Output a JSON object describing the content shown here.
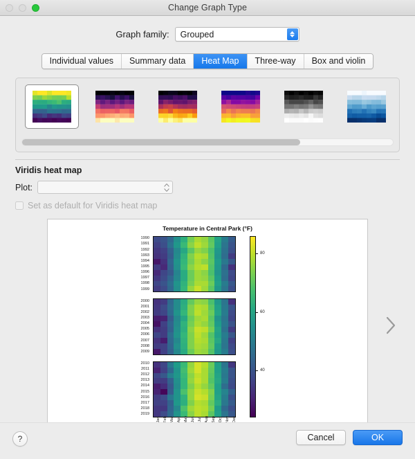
{
  "window": {
    "title": "Change Graph Type",
    "traffic_lights": [
      "close-disabled",
      "minimize-disabled",
      "zoom-green"
    ]
  },
  "family": {
    "label": "Graph family:",
    "selected": "Grouped",
    "stepper_icon": "stepper-up-down-icon"
  },
  "tabs": [
    {
      "label": "Individual values",
      "selected": false
    },
    {
      "label": "Summary data",
      "selected": false
    },
    {
      "label": "Heat Map",
      "selected": true
    },
    {
      "label": "Three-way",
      "selected": false
    },
    {
      "label": "Box and violin",
      "selected": false
    }
  ],
  "gallery": {
    "thumbnails": [
      {
        "name": "viridis-heat-map-thumb",
        "colormap": "viridis",
        "selected": true
      },
      {
        "name": "magma-heat-map-thumb",
        "colormap": "magma",
        "selected": false
      },
      {
        "name": "inferno-heat-map-thumb",
        "colormap": "inferno",
        "selected": false
      },
      {
        "name": "plasma-heat-map-thumb",
        "colormap": "plasma",
        "selected": false
      },
      {
        "name": "greys-heat-map-thumb",
        "colormap": "greys",
        "selected": false
      },
      {
        "name": "blues-heat-map-thumb",
        "colormap": "blues",
        "selected": false
      }
    ],
    "scroll_thumb_percent": 75
  },
  "section": {
    "title": "Viridis heat map",
    "plot_label": "Plot:",
    "plot_value": "",
    "checkbox_label": "Set as default for Viridis heat map",
    "checkbox_checked": false,
    "checkbox_enabled": false
  },
  "preview": {
    "next_arrow_icon": "chevron-right-icon"
  },
  "footer": {
    "help_label": "?",
    "cancel_label": "Cancel",
    "ok_label": "OK",
    "ok_color": "#1876e8"
  },
  "chart_data": {
    "type": "heatmap",
    "title": "Temperature in Central Park (°F)",
    "xlabel": "",
    "ylabel": "",
    "colormap": "viridis",
    "colorbar": {
      "ticks": [
        40,
        60,
        80
      ],
      "min": 24,
      "max": 86
    },
    "categories": [
      "Jan",
      "Feb",
      "Mar",
      "Apr",
      "May",
      "Jun",
      "Jul",
      "Aug",
      "Sep",
      "Oct",
      "Nov",
      "Dec"
    ],
    "row_blocks": [
      {
        "rows": [
          "1990",
          "1991",
          "1992",
          "1993",
          "1994",
          "1995",
          "1996",
          "1997",
          "1998",
          "1999"
        ],
        "values": [
          [
            38,
            40,
            45,
            55,
            63,
            73,
            78,
            76,
            70,
            60,
            50,
            42
          ],
          [
            36,
            39,
            47,
            57,
            66,
            75,
            80,
            77,
            71,
            59,
            48,
            40
          ],
          [
            34,
            36,
            43,
            53,
            61,
            70,
            76,
            74,
            68,
            57,
            47,
            39
          ],
          [
            33,
            35,
            42,
            54,
            64,
            74,
            79,
            78,
            69,
            56,
            46,
            35
          ],
          [
            28,
            33,
            44,
            56,
            65,
            73,
            78,
            75,
            70,
            58,
            49,
            41
          ],
          [
            35,
            31,
            43,
            55,
            66,
            75,
            79,
            80,
            69,
            57,
            45,
            33
          ],
          [
            31,
            37,
            41,
            52,
            62,
            72,
            77,
            75,
            68,
            56,
            47,
            38
          ],
          [
            34,
            38,
            44,
            53,
            62,
            72,
            77,
            76,
            70,
            58,
            46,
            37
          ],
          [
            37,
            40,
            46,
            56,
            64,
            73,
            78,
            78,
            72,
            59,
            50,
            41
          ],
          [
            35,
            38,
            45,
            55,
            65,
            76,
            81,
            77,
            70,
            57,
            48,
            39
          ]
        ]
      },
      {
        "rows": [
          "2000",
          "2001",
          "2002",
          "2003",
          "2004",
          "2005",
          "2006",
          "2007",
          "2008",
          "2009"
        ],
        "values": [
          [
            33,
            35,
            45,
            54,
            62,
            71,
            76,
            75,
            68,
            57,
            48,
            33
          ],
          [
            34,
            38,
            46,
            54,
            63,
            74,
            79,
            78,
            70,
            59,
            49,
            40
          ],
          [
            35,
            37,
            45,
            56,
            65,
            74,
            80,
            77,
            72,
            60,
            50,
            38
          ],
          [
            29,
            30,
            42,
            53,
            61,
            72,
            77,
            78,
            70,
            56,
            48,
            37
          ],
          [
            27,
            36,
            44,
            54,
            64,
            73,
            78,
            76,
            71,
            58,
            49,
            40
          ],
          [
            33,
            35,
            43,
            55,
            63,
            75,
            81,
            80,
            73,
            60,
            47,
            35
          ],
          [
            37,
            35,
            46,
            56,
            65,
            74,
            80,
            77,
            69,
            59,
            50,
            41
          ],
          [
            33,
            29,
            45,
            53,
            64,
            74,
            79,
            78,
            70,
            61,
            49,
            36
          ],
          [
            35,
            36,
            44,
            55,
            63,
            74,
            78,
            77,
            71,
            58,
            48,
            38
          ],
          [
            28,
            36,
            43,
            53,
            62,
            72,
            77,
            76,
            69,
            57,
            50,
            39
          ]
        ]
      },
      {
        "rows": [
          "2010",
          "2011",
          "2012",
          "2013",
          "2014",
          "2015",
          "2016",
          "2017",
          "2018",
          "2019"
        ],
        "values": [
          [
            33,
            37,
            49,
            58,
            66,
            76,
            82,
            79,
            72,
            59,
            48,
            34
          ],
          [
            30,
            36,
            45,
            56,
            67,
            77,
            82,
            78,
            71,
            59,
            50,
            40
          ],
          [
            37,
            41,
            51,
            57,
            66,
            75,
            80,
            78,
            70,
            60,
            49,
            40
          ],
          [
            35,
            35,
            43,
            55,
            65,
            76,
            81,
            78,
            69,
            61,
            50,
            39
          ],
          [
            29,
            32,
            41,
            54,
            65,
            74,
            79,
            76,
            71,
            59,
            46,
            38
          ],
          [
            30,
            25,
            42,
            56,
            68,
            76,
            81,
            79,
            74,
            59,
            52,
            43
          ],
          [
            35,
            38,
            49,
            56,
            64,
            76,
            82,
            81,
            73,
            60,
            50,
            39
          ],
          [
            36,
            36,
            43,
            57,
            63,
            74,
            79,
            78,
            71,
            62,
            49,
            42
          ],
          [
            34,
            34,
            44,
            53,
            68,
            77,
            80,
            79,
            73,
            58,
            45,
            39
          ],
          [
            34,
            38,
            45,
            56,
            66,
            75,
            80,
            78,
            70,
            59,
            48,
            41
          ]
        ]
      }
    ]
  }
}
